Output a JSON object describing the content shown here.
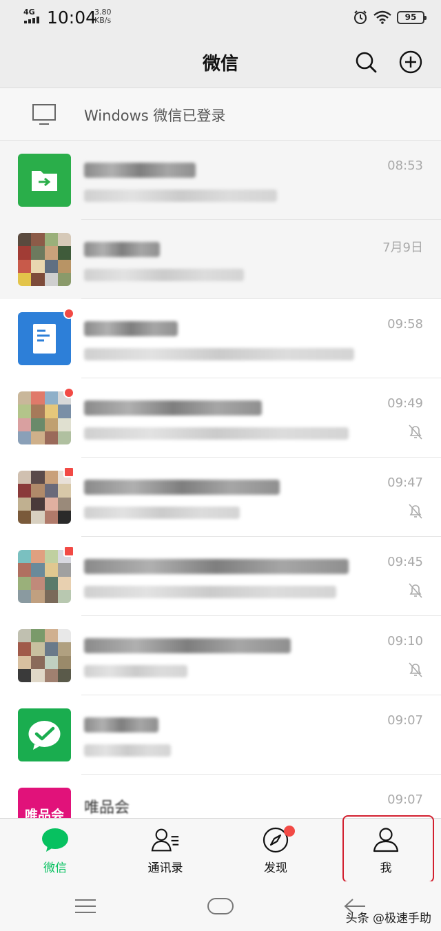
{
  "status_bar": {
    "network": "4G",
    "time": "10:04",
    "speed_value": "3.80",
    "speed_unit": "KB/s",
    "battery": "95",
    "icons": [
      "signal-bars-icon",
      "alarm-clock-icon",
      "wifi-icon",
      "battery-icon"
    ]
  },
  "header": {
    "title": "微信",
    "icons": [
      "search-icon",
      "add-circle-icon"
    ]
  },
  "login_banner": {
    "icon": "desktop-monitor-icon",
    "text": "Windows 微信已登录"
  },
  "chats": [
    {
      "time": "08:53",
      "pinned": true,
      "muted": false,
      "unread_dot": false,
      "avatar": "file-transfer-icon"
    },
    {
      "time": "7月9日",
      "pinned": true,
      "muted": false,
      "unread_dot": false,
      "avatar": "photo-avatar"
    },
    {
      "time": "09:58",
      "pinned": false,
      "muted": false,
      "unread_dot": true,
      "avatar": "document-app-icon"
    },
    {
      "time": "09:49",
      "pinned": false,
      "muted": true,
      "unread_dot": true,
      "avatar": "group-avatar"
    },
    {
      "time": "09:47",
      "pinned": false,
      "muted": true,
      "unread_dot": true,
      "avatar": "group-avatar"
    },
    {
      "time": "09:45",
      "pinned": false,
      "muted": true,
      "unread_dot": true,
      "avatar": "group-avatar"
    },
    {
      "time": "09:10",
      "pinned": false,
      "muted": true,
      "unread_dot": false,
      "avatar": "group-avatar"
    },
    {
      "time": "09:07",
      "pinned": false,
      "muted": false,
      "unread_dot": false,
      "avatar": "wechat-pay-icon"
    },
    {
      "time": "09:07",
      "pinned": false,
      "muted": false,
      "unread_dot": false,
      "avatar": "vip-logo",
      "avatar_text": "唯品会",
      "name": "唯品会"
    }
  ],
  "bottom_nav": {
    "items": [
      {
        "label": "微信",
        "icon": "chat-bubble-icon",
        "active": true
      },
      {
        "label": "通讯录",
        "icon": "contacts-icon",
        "active": false
      },
      {
        "label": "发现",
        "icon": "compass-icon",
        "active": false,
        "badge_dot": true
      },
      {
        "label": "我",
        "icon": "person-icon",
        "active": false,
        "highlighted": true
      }
    ]
  },
  "system_nav": {
    "icons": [
      "menu-icon",
      "home-icon",
      "back-icon"
    ]
  },
  "watermark": "头条 @极速手助",
  "colors": {
    "accent_green": "#07c160",
    "badge_red": "#f24a45",
    "highlight_red": "#d2202f",
    "header_bg": "#ededed"
  }
}
